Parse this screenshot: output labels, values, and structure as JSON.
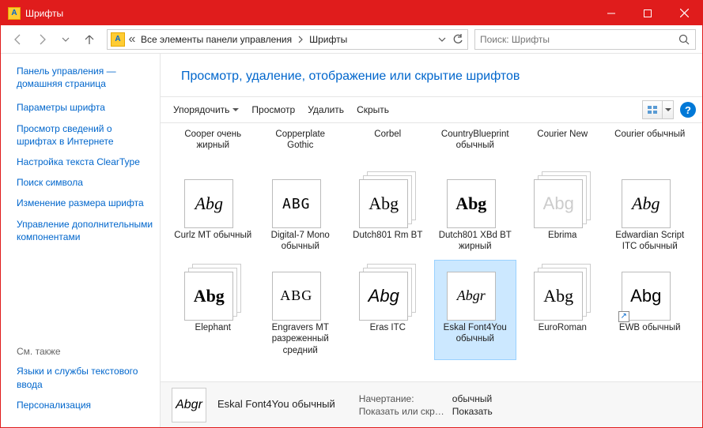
{
  "window": {
    "title": "Шрифты"
  },
  "breadcrumb": {
    "root": "Все элементы панели управления",
    "current": "Шрифты"
  },
  "search": {
    "placeholder": "Поиск: Шрифты"
  },
  "sidebar": {
    "home": "Панель управления — домашняя страница",
    "links": [
      "Параметры шрифта",
      "Просмотр сведений о шрифтах в Интернете",
      "Настройка текста ClearType",
      "Поиск символа",
      "Изменение размера шрифта",
      "Управление дополнительными компонентами"
    ],
    "seealso": "См. также",
    "seelinks": [
      "Языки и службы текстового ввода",
      "Персонализация"
    ]
  },
  "page": {
    "title": "Просмотр, удаление, отображение или скрытие шрифтов"
  },
  "toolbar": {
    "organize": "Упорядочить",
    "preview": "Просмотр",
    "delete": "Удалить",
    "hide": "Скрыть"
  },
  "fonts": {
    "row0": [
      {
        "label": "Cooper очень жирный"
      },
      {
        "label": "Copperplate Gothic"
      },
      {
        "label": "Corbel"
      },
      {
        "label": "CountryBlueprint обычный"
      },
      {
        "label": "Courier New"
      },
      {
        "label": "Courier обычный"
      }
    ],
    "row1": [
      {
        "label": "Curlz MT обычный",
        "sample": "Abg",
        "style": "font-style:italic;font-family:cursive"
      },
      {
        "label": "Digital-7 Mono обычный",
        "sample": "ABG",
        "style": "font-family:monospace;letter-spacing:1px;font-size:18px"
      },
      {
        "label": "Dutch801 Rm BT",
        "sample": "Abg",
        "style": "font-family:serif",
        "stack": true
      },
      {
        "label": "Dutch801 XBd BT жирный",
        "sample": "Abg",
        "style": "font-family:serif;font-weight:900"
      },
      {
        "label": "Ebrima",
        "sample": "Abg",
        "style": "color:#ccc",
        "stack": true
      },
      {
        "label": "Edwardian Script ITC обычный",
        "sample": "Abg",
        "style": "font-style:italic;font-family:cursive"
      }
    ],
    "row2": [
      {
        "label": "Elephant",
        "sample": "Abg",
        "style": "font-family:serif;font-weight:900",
        "stack": true
      },
      {
        "label": "Engravers MT разреженный средний",
        "sample": "ABG",
        "style": "font-family:serif;letter-spacing:1px;font-size:18px"
      },
      {
        "label": "Eras ITC",
        "sample": "Abg",
        "style": "font-style:italic",
        "stack": true
      },
      {
        "label": "Eskal Font4You обычный",
        "sample": "Abgr",
        "style": "font-style:italic;font-family:cursive;font-size:18px",
        "selected": true
      },
      {
        "label": "EuroRoman",
        "sample": "Abg",
        "style": "font-family:serif",
        "stack": true
      },
      {
        "label": "EWB обычный",
        "sample": "Abg",
        "style": "font-family:sans-serif",
        "shortcut": true
      }
    ]
  },
  "details": {
    "name": "Eskal Font4You обычный",
    "k1": "Начертание:",
    "v1": "обычный",
    "k2": "Показать или скр…",
    "v2": "Показать"
  }
}
